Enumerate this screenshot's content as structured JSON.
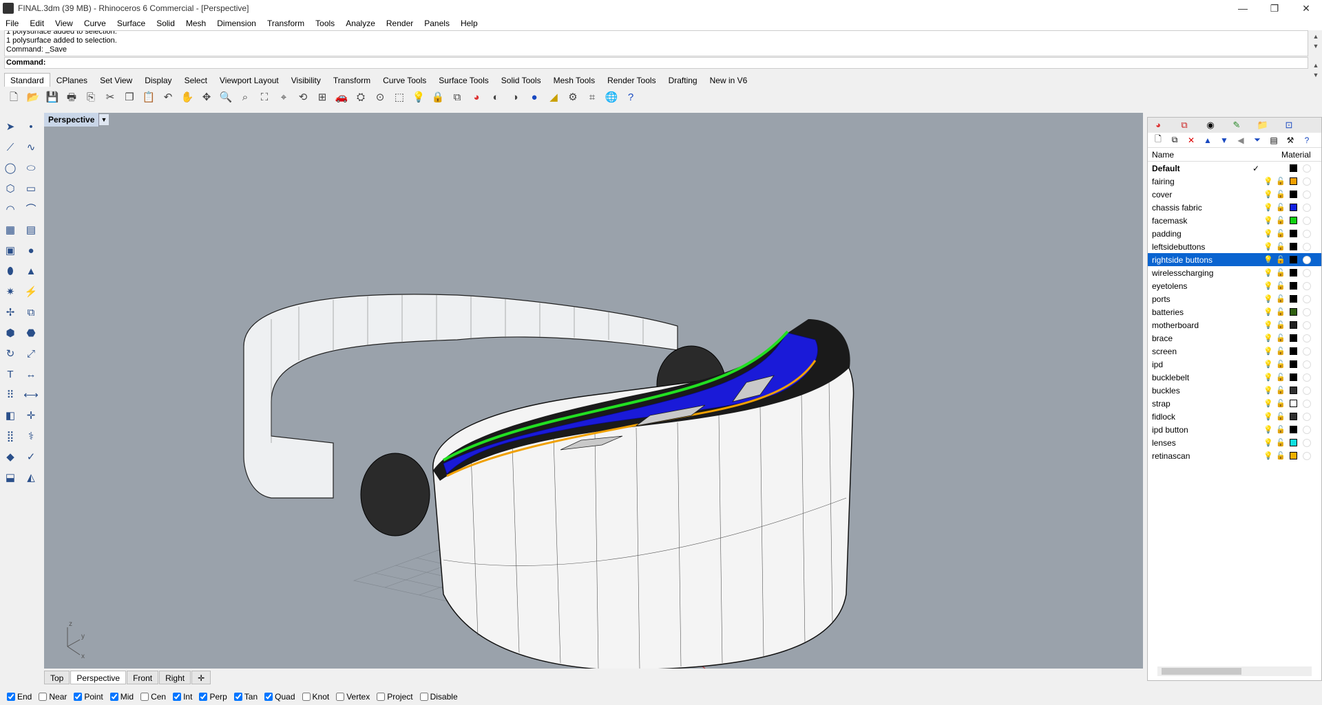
{
  "window": {
    "title": "FINAL.3dm (39 MB) - Rhinoceros 6 Commercial - [Perspective]",
    "minimize": "—",
    "restore": "❐",
    "close": "✕"
  },
  "menu": [
    "File",
    "Edit",
    "View",
    "Curve",
    "Surface",
    "Solid",
    "Mesh",
    "Dimension",
    "Transform",
    "Tools",
    "Analyze",
    "Render",
    "Panels",
    "Help"
  ],
  "command_history": [
    "1 polysurface added to selection.",
    "1 polysurface added to selection.",
    "Command: _Save"
  ],
  "command_prompt": "Command:",
  "toolbar_tabs": [
    "Standard",
    "CPlanes",
    "Set View",
    "Display",
    "Select",
    "Viewport Layout",
    "Visibility",
    "Transform",
    "Curve Tools",
    "Surface Tools",
    "Solid Tools",
    "Mesh Tools",
    "Render Tools",
    "Drafting",
    "New in V6"
  ],
  "viewport": {
    "name": "Perspective",
    "axes": {
      "z": "z",
      "y": "y",
      "x": "x"
    }
  },
  "viewport_tabs": [
    "Top",
    "Perspective",
    "Front",
    "Right"
  ],
  "osnaps": [
    {
      "label": "End",
      "checked": true
    },
    {
      "label": "Near",
      "checked": false
    },
    {
      "label": "Point",
      "checked": true
    },
    {
      "label": "Mid",
      "checked": true
    },
    {
      "label": "Cen",
      "checked": false
    },
    {
      "label": "Int",
      "checked": true
    },
    {
      "label": "Perp",
      "checked": true
    },
    {
      "label": "Tan",
      "checked": true
    },
    {
      "label": "Quad",
      "checked": true
    },
    {
      "label": "Knot",
      "checked": false
    },
    {
      "label": "Vertex",
      "checked": false
    },
    {
      "label": "Project",
      "checked": false
    },
    {
      "label": "Disable",
      "checked": false
    }
  ],
  "layers_panel": {
    "col_name": "Name",
    "col_material": "Material",
    "layers": [
      {
        "name": "Default",
        "color": "#000000",
        "current": "✓",
        "selected": false
      },
      {
        "name": "fairing",
        "color": "#f0a000",
        "selected": false
      },
      {
        "name": "cover",
        "color": "#000000",
        "selected": false
      },
      {
        "name": "chassis fabric",
        "color": "#1020e0",
        "selected": false
      },
      {
        "name": "facemask",
        "color": "#10d010",
        "selected": false
      },
      {
        "name": "padding",
        "color": "#000000",
        "selected": false
      },
      {
        "name": "leftsidebuttons",
        "color": "#000000",
        "selected": false
      },
      {
        "name": "rightside buttons",
        "color": "#000000",
        "selected": true
      },
      {
        "name": "wirelesscharging",
        "color": "#000000",
        "selected": false
      },
      {
        "name": "eyetolens",
        "color": "#000000",
        "selected": false
      },
      {
        "name": "ports",
        "color": "#000000",
        "selected": false
      },
      {
        "name": "batteries",
        "color": "#306010",
        "selected": false
      },
      {
        "name": "motherboard",
        "color": "#202020",
        "selected": false
      },
      {
        "name": "brace",
        "color": "#000000",
        "selected": false
      },
      {
        "name": "screen",
        "color": "#000000",
        "selected": false
      },
      {
        "name": "ipd",
        "color": "#000000",
        "selected": false
      },
      {
        "name": "bucklebelt",
        "color": "#000000",
        "selected": false
      },
      {
        "name": "buckles",
        "color": "#303030",
        "selected": false
      },
      {
        "name": "strap",
        "color": "#ffffff",
        "selected": false
      },
      {
        "name": "fidlock",
        "color": "#303030",
        "selected": false
      },
      {
        "name": "ipd button",
        "color": "#000000",
        "selected": false
      },
      {
        "name": "lenses",
        "color": "#10e0e0",
        "selected": false
      },
      {
        "name": "retinascan",
        "color": "#f0b000",
        "selected": false
      }
    ]
  }
}
